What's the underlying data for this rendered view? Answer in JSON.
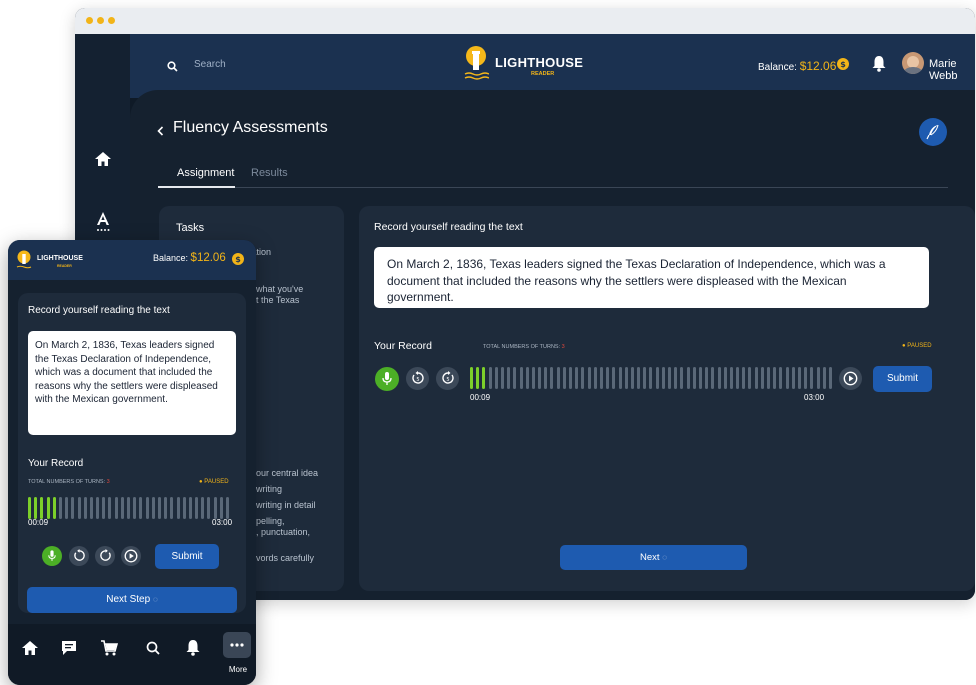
{
  "brand": {
    "name": "LIGHTHOUSE",
    "sub": "READER"
  },
  "desktop": {
    "search_placeholder": "Search",
    "balance_label": "Balance:",
    "balance_value": "$12.06",
    "user_name": "Marie Webb",
    "page_title": "Fluency Assessments",
    "tabs": [
      {
        "label": "Assignment",
        "active": true
      },
      {
        "label": "Results",
        "active": false
      }
    ],
    "tasks_title": "Tasks",
    "tasks_fragments": [
      "ormation",
      "what you've",
      "t the Texas",
      "our central idea",
      "writing",
      "writing in detail",
      "pelling,",
      ", punctuation,",
      "vords carefully"
    ],
    "record_heading": "Record yourself reading the text",
    "passage": "On March 2, 1836, Texas leaders signed the Texas Declaration of Independence, which was a document that included the reasons why the settlers were displeased with the Mexican government.",
    "your_record": "Your Record",
    "turns_label": "TOTAL NUMBERS OF TURNS:",
    "turns_value": "3",
    "status": "PAUSED",
    "time_elapsed": "00:09",
    "time_total": "03:00",
    "progress_fraction": 0.05,
    "submit_label": "Submit",
    "next_label": "Next"
  },
  "mobile": {
    "balance_label": "Balance:",
    "balance_value": "$12.06",
    "record_heading": "Record yourself reading the text",
    "passage": "On March 2, 1836, Texas leaders signed the Texas Declaration of Independence, which was  a document that included the reasons why the settlers were displeased with the Mexican government.",
    "your_record": "Your Record",
    "turns_label": "TOTAL NUMBERS OF TURNS:",
    "turns_value": "3",
    "status": "PAUSED",
    "time_elapsed": "00:09",
    "time_total": "03:00",
    "progress_fraction": 0.15,
    "submit_label": "Submit",
    "next_step_label": "Next Step",
    "more_label": "More"
  },
  "colors": {
    "accent_blue": "#1e5bb0",
    "mic_green": "#4caf26",
    "wave_active": "#7ccf2a",
    "status_yellow": "#f2b418",
    "turns_red": "#e0483c"
  },
  "icons": [
    "home-icon",
    "font-icon",
    "search-icon",
    "coin-icon",
    "bell-icon",
    "chevron-down-icon",
    "chevron-left-icon",
    "quill-icon",
    "mic-icon",
    "rewind-icon",
    "forward-icon",
    "play-icon",
    "chat-icon",
    "cart-icon",
    "more-icon",
    "loading-icon"
  ]
}
